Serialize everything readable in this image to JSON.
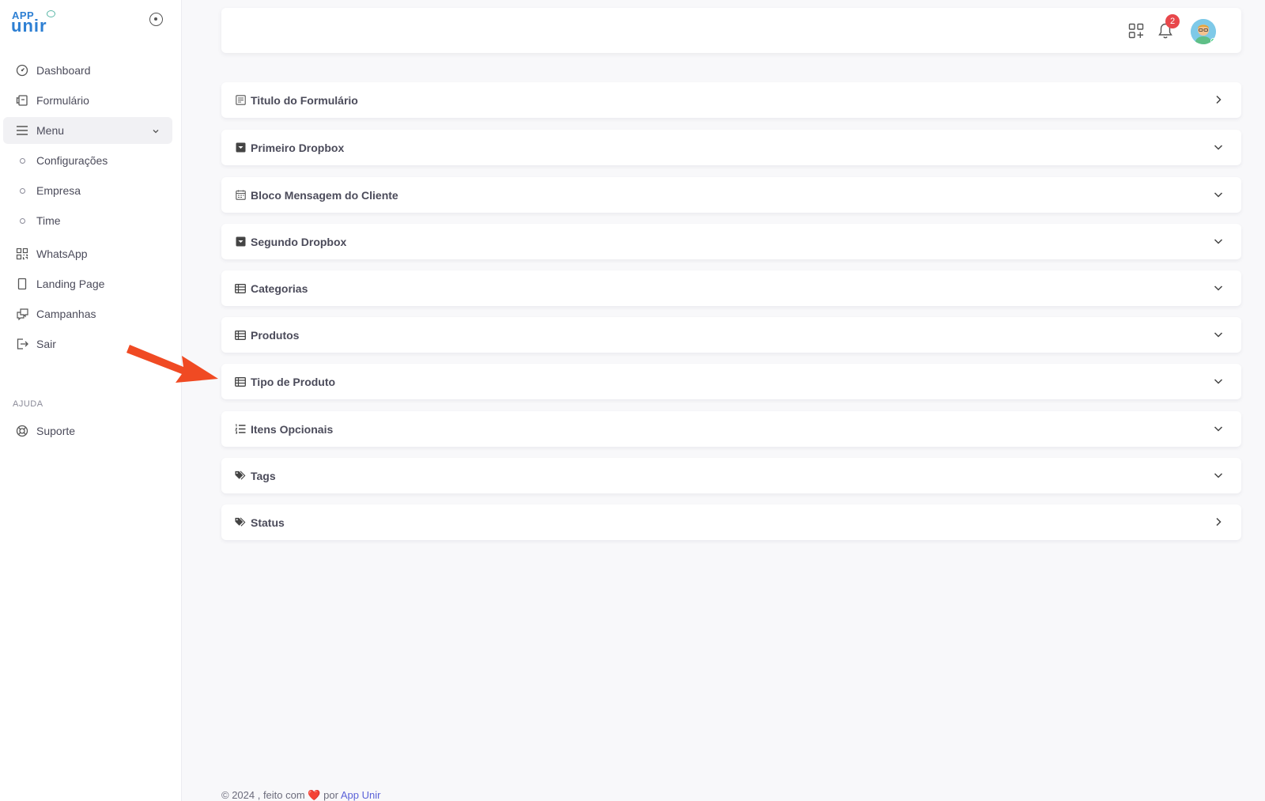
{
  "brand": {
    "line1": "APP",
    "line2": "unir"
  },
  "sidebar": {
    "items": [
      {
        "label": "Dashboard",
        "icon": "dashboard-icon"
      },
      {
        "label": "Formulário",
        "icon": "form-icon"
      },
      {
        "label": "Menu",
        "icon": "menu-icon"
      },
      {
        "label": "Configurações",
        "icon": "circle-bullet-icon"
      },
      {
        "label": "Empresa",
        "icon": "circle-bullet-icon"
      },
      {
        "label": "Time",
        "icon": "circle-bullet-icon"
      },
      {
        "label": "WhatsApp",
        "icon": "qrcode-icon"
      },
      {
        "label": "Landing Page",
        "icon": "page-icon"
      },
      {
        "label": "Campanhas",
        "icon": "chat-icon"
      },
      {
        "label": "Sair",
        "icon": "logout-icon"
      }
    ],
    "section_label": "AJUDA",
    "support_label": "Suporte"
  },
  "topbar": {
    "notification_count": "2"
  },
  "accordion": [
    {
      "label": "Titulo do Formulário",
      "icon": "form-title-icon",
      "state": "collapsed-right"
    },
    {
      "label": "Primeiro Dropbox",
      "icon": "dropdown-box-icon",
      "state": "expandable"
    },
    {
      "label": "Bloco Mensagem do Cliente",
      "icon": "calendar-icon",
      "state": "expandable"
    },
    {
      "label": "Segundo Dropbox",
      "icon": "dropdown-box-icon",
      "state": "expandable"
    },
    {
      "label": "Categorias",
      "icon": "table-icon",
      "state": "expandable"
    },
    {
      "label": "Produtos",
      "icon": "table-icon",
      "state": "expandable"
    },
    {
      "label": "Tipo de Produto",
      "icon": "table-icon",
      "state": "expandable"
    },
    {
      "label": "Itens Opcionais",
      "icon": "list-ordered-icon",
      "state": "expandable"
    },
    {
      "label": "Tags",
      "icon": "tags-icon",
      "state": "expandable"
    },
    {
      "label": "Status",
      "icon": "tags-icon",
      "state": "collapsed-right"
    }
  ],
  "footer": {
    "prefix": "© 2024 , feito com",
    "by": "por",
    "link": "App Unir"
  },
  "colors": {
    "accent": "#5b62d8",
    "annotation_arrow": "#f04a23",
    "badge": "#e8474b",
    "brand": "#2d7fd3"
  }
}
